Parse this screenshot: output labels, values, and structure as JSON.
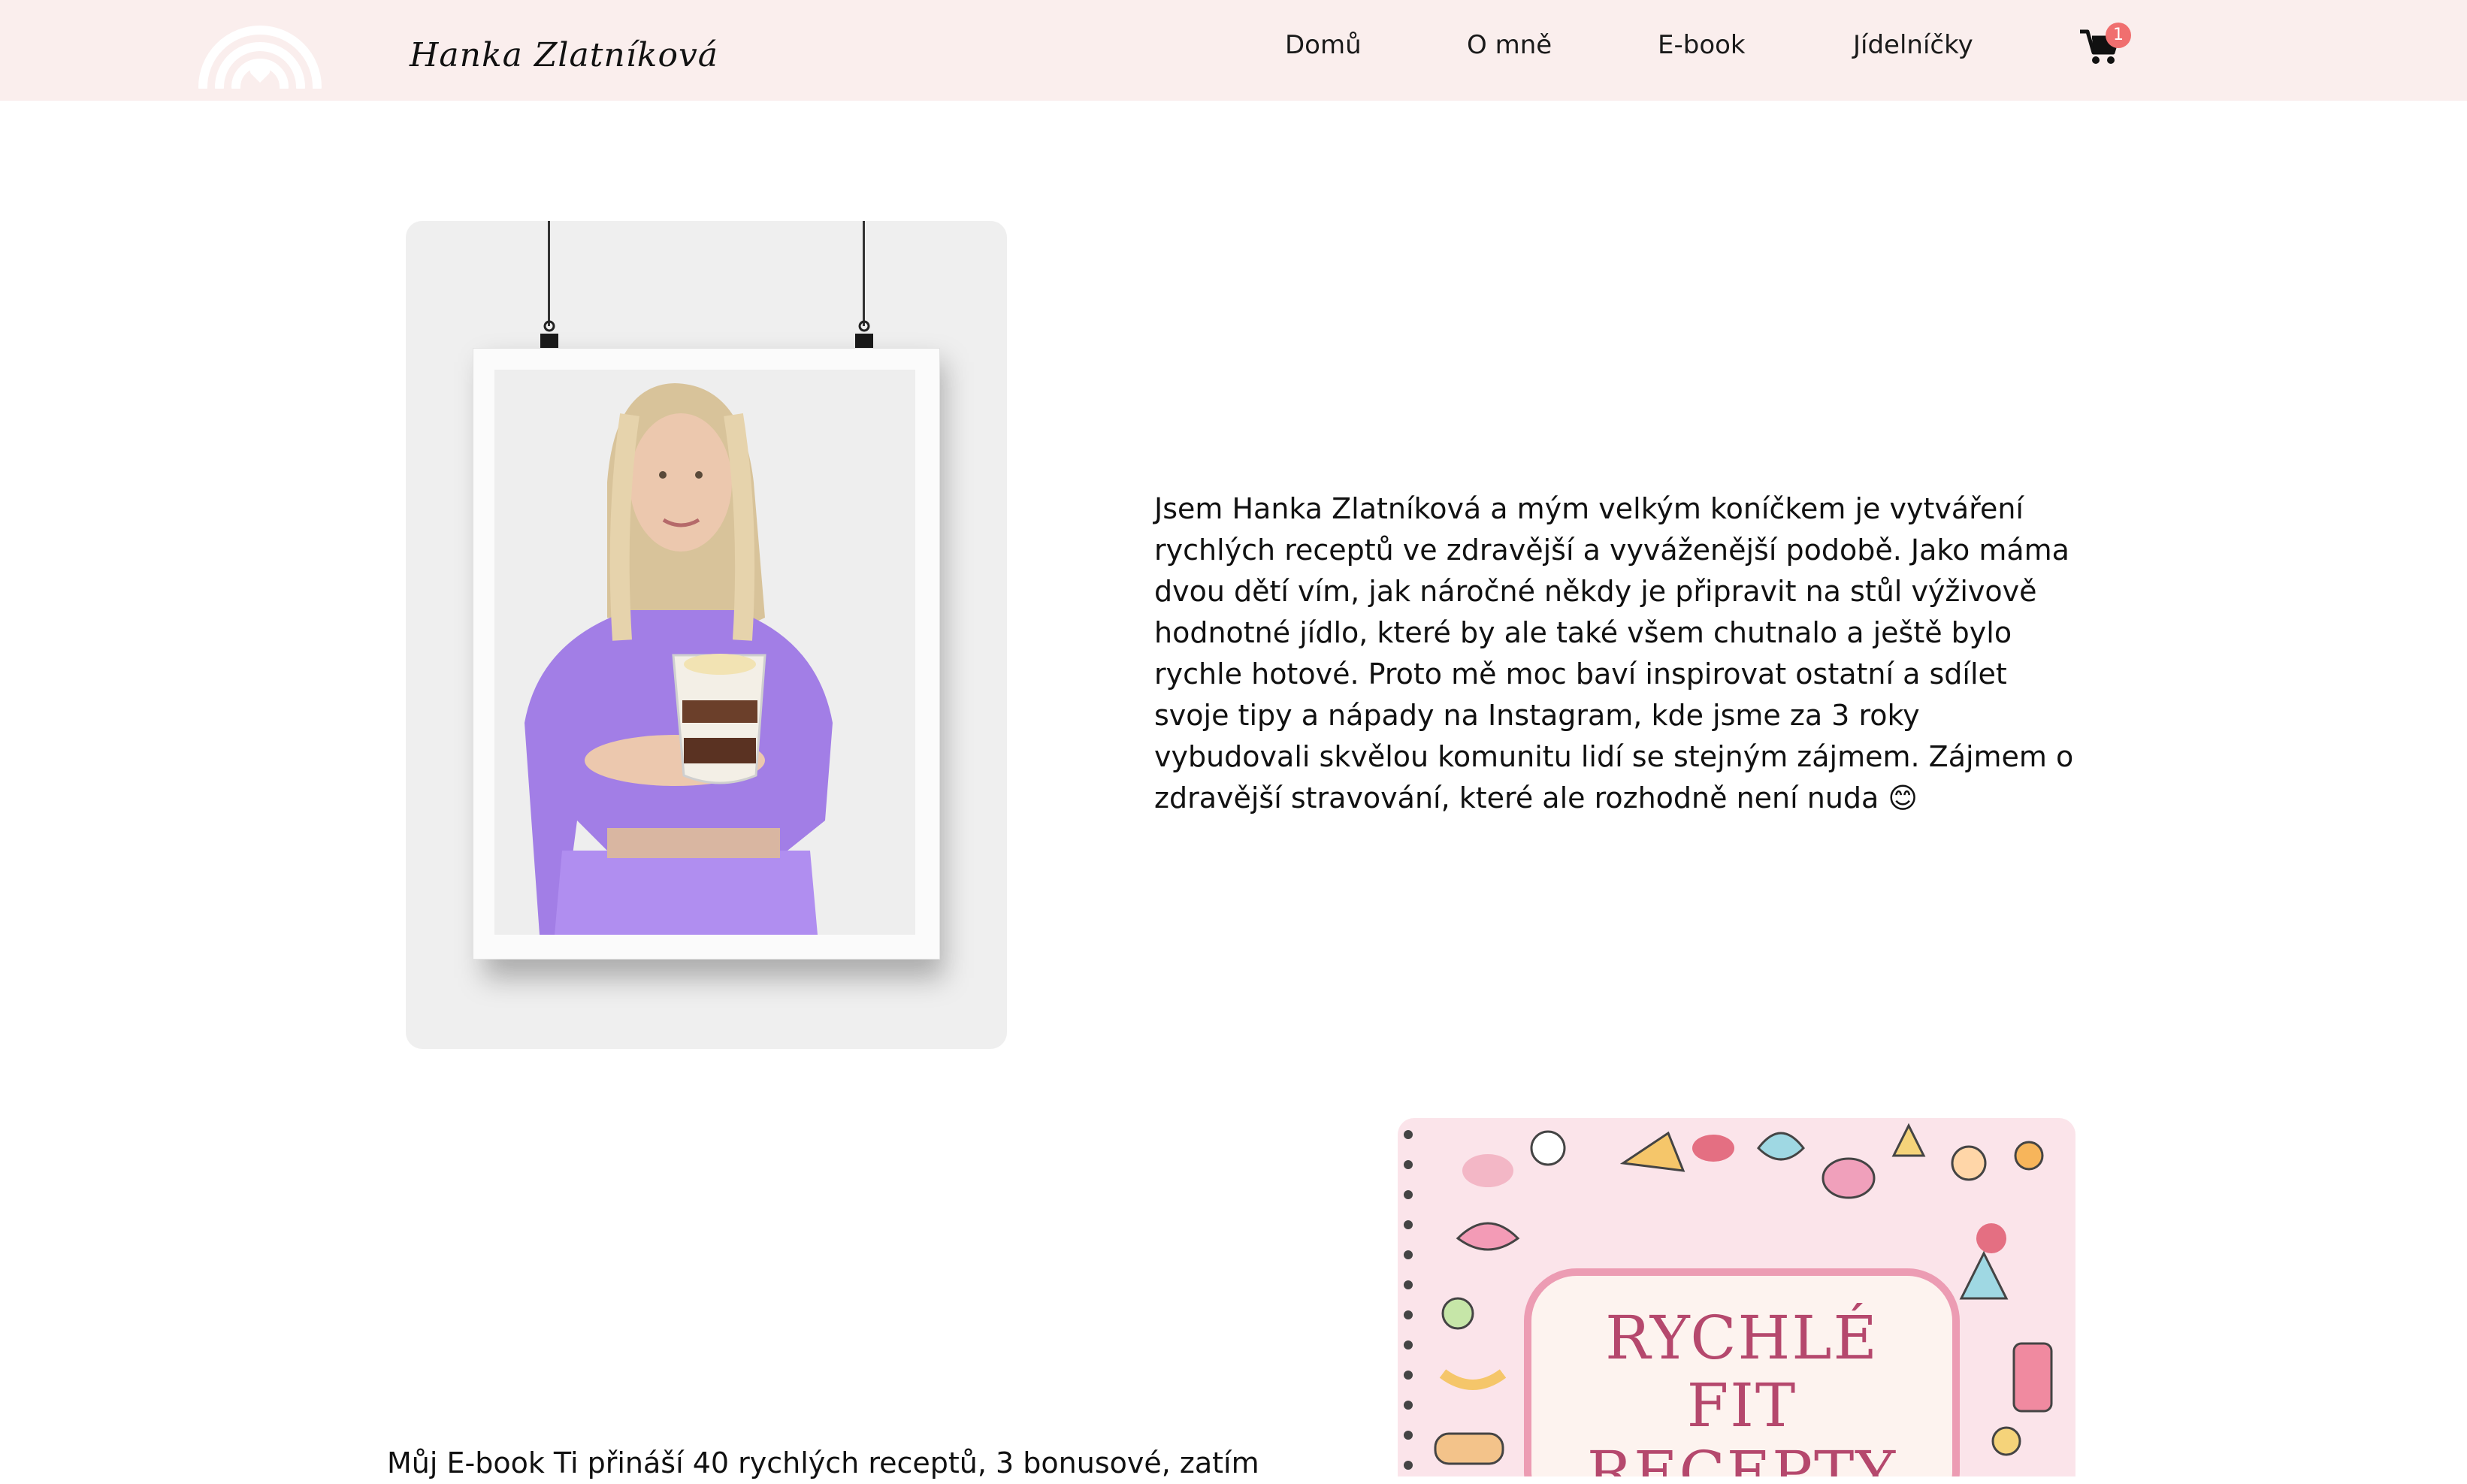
{
  "brand": {
    "name": "Hanka Zlatníková",
    "logo_icon": "rainbow-heart-icon"
  },
  "nav": {
    "items": [
      {
        "label": "Domů"
      },
      {
        "label": "O mně"
      },
      {
        "label": "E-book"
      },
      {
        "label": "Jídelníčky"
      }
    ],
    "cart_icon": "shopping-cart-icon",
    "cart_count": "1"
  },
  "about": {
    "text": "Jsem Hanka Zlatníková a mým velkým koníčkem je vytváření rychlých receptů ve zdravější a vyváženější podobě. Jako máma dvou dětí vím, jak náročné někdy je připravit na stůl výživově hodnotné jídlo, které by ale také všem chutnalo a ještě bylo rychle hotové. Proto mě moc baví inspirovat ostatní a sdílet svoje tipy a nápady na Instagram, kde jsme za 3 roky vybudovali skvělou komunitu lidí se stejným zájmem. Zájmem o zdravější stravování, které ale rozhodně není nuda 😊"
  },
  "ebook": {
    "text": "Můj E-book Ti přináší 40 rychlých receptů, 3 bonusové, zatím",
    "cover_title_line1": "RYCHLÉ",
    "cover_title_line2": "FIT RECEPTY"
  },
  "colors": {
    "header_bg": "#faeeed",
    "badge": "#f06f6f",
    "cover_title": "#b5486d",
    "cover_bg": "#fbe4ea"
  }
}
